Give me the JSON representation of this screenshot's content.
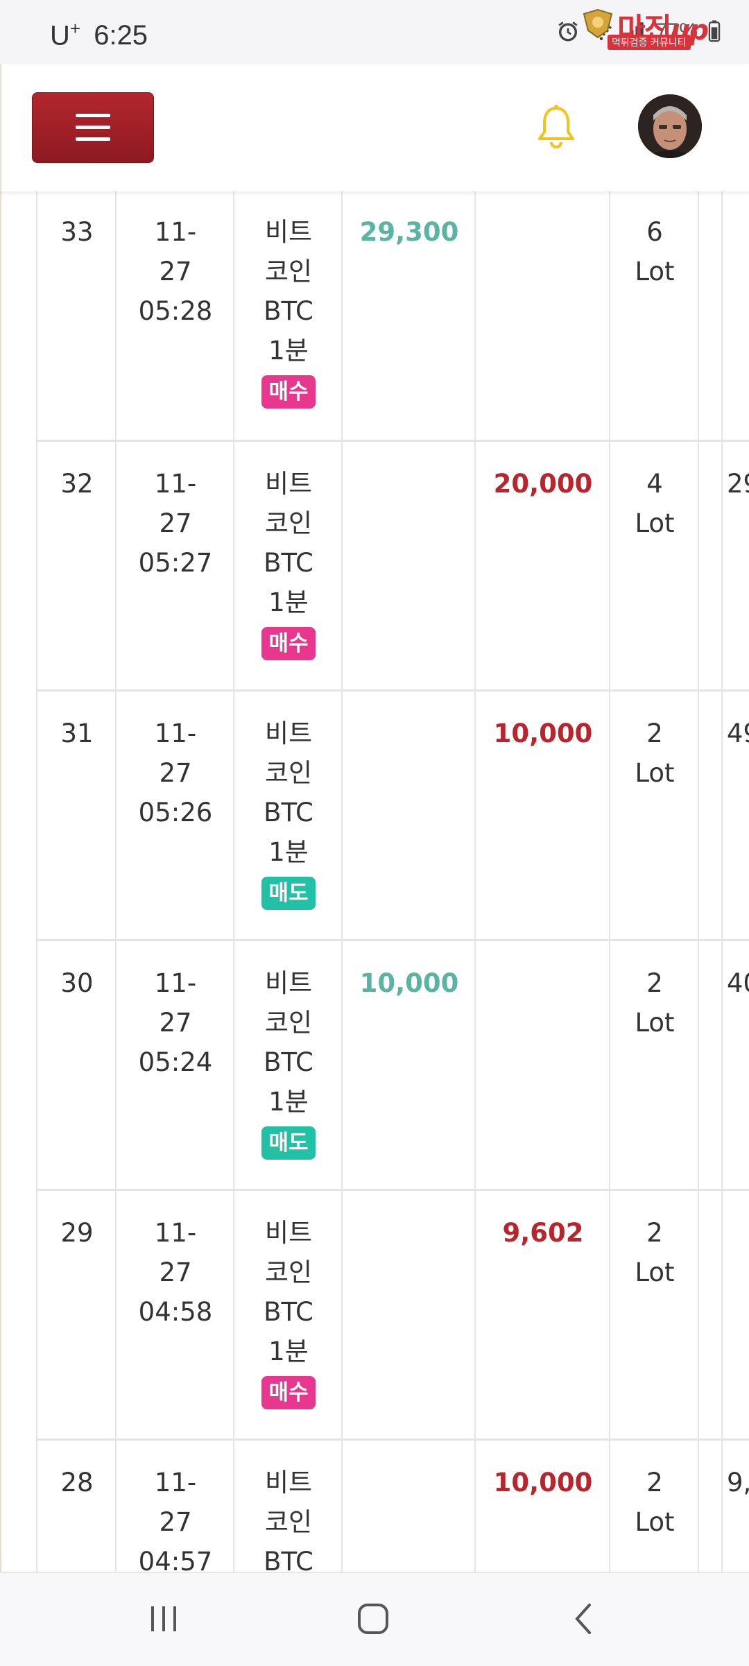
{
  "status_bar": {
    "carrier": "U",
    "carrier_plus": "+",
    "time": "6:25",
    "battery": "77%",
    "icons": [
      "alarm-icon",
      "wifi-icon",
      "signal-icon",
      "battery-icon"
    ]
  },
  "watermark": {
    "brand": "마진",
    "brand_suffix": "up",
    "tagline": "먹튀검증 커뮤니티",
    "color": "#d9323a"
  },
  "header": {
    "menu_icon": "hamburger-icon",
    "notification_icon": "bell-icon",
    "avatar_icon": "user-avatar"
  },
  "table": {
    "rows": [
      {
        "no": "33",
        "date": "11-",
        "date2": "27",
        "time": "05:28",
        "item1": "비트",
        "item2": "코인",
        "item3": "BTC",
        "item4": "1분",
        "type": "매수",
        "type_kind": "buy",
        "profit": "29,300",
        "loss": "",
        "lot_qty": "6",
        "lot_unit": "Lot",
        "extra": ""
      },
      {
        "no": "32",
        "date": "11-",
        "date2": "27",
        "time": "05:27",
        "item1": "비트",
        "item2": "코인",
        "item3": "BTC",
        "item4": "1분",
        "type": "매수",
        "type_kind": "buy",
        "profit": "",
        "loss": "20,000",
        "lot_qty": "4",
        "lot_unit": "Lot",
        "extra": "29"
      },
      {
        "no": "31",
        "date": "11-",
        "date2": "27",
        "time": "05:26",
        "item1": "비트",
        "item2": "코인",
        "item3": "BTC",
        "item4": "1분",
        "type": "매도",
        "type_kind": "sell",
        "profit": "",
        "loss": "10,000",
        "lot_qty": "2",
        "lot_unit": "Lot",
        "extra": "49"
      },
      {
        "no": "30",
        "date": "11-",
        "date2": "27",
        "time": "05:24",
        "item1": "비트",
        "item2": "코인",
        "item3": "BTC",
        "item4": "1분",
        "type": "매도",
        "type_kind": "sell",
        "profit": "10,000",
        "loss": "",
        "lot_qty": "2",
        "lot_unit": "Lot",
        "extra": "40"
      },
      {
        "no": "29",
        "date": "11-",
        "date2": "27",
        "time": "04:58",
        "item1": "비트",
        "item2": "코인",
        "item3": "BTC",
        "item4": "1분",
        "type": "매수",
        "type_kind": "buy",
        "profit": "",
        "loss": "9,602",
        "lot_qty": "2",
        "lot_unit": "Lot",
        "extra": ""
      },
      {
        "no": "28",
        "date": "11-",
        "date2": "27",
        "time": "04:57",
        "item1": "비트",
        "item2": "코인",
        "item3": "BTC",
        "item4": "",
        "type": "",
        "type_kind": "",
        "profit": "",
        "loss": "10,000",
        "lot_qty": "2",
        "lot_unit": "Lot",
        "extra": "9,"
      }
    ],
    "colors": {
      "profit": "#5bb3a3",
      "loss": "#b8252d",
      "buy": "#e8378e",
      "sell": "#22c1a5"
    }
  },
  "nav_bar": {
    "icons": [
      "recent-apps-icon",
      "home-icon",
      "back-icon"
    ]
  }
}
